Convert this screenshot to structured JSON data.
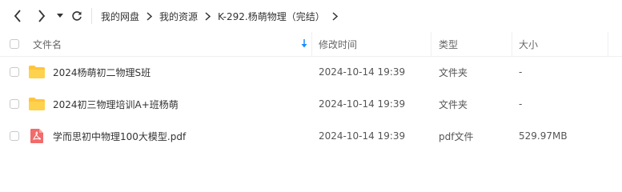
{
  "toolbar": {
    "icons": [
      "back-icon",
      "forward-icon",
      "history-dropdown-icon",
      "refresh-icon"
    ]
  },
  "breadcrumb": {
    "items": [
      "我的网盘",
      "我的资源",
      "K-292.杨萌物理（完结）"
    ]
  },
  "columns": {
    "name": "文件名",
    "modified": "修改时间",
    "type": "类型",
    "size": "大小"
  },
  "sort": {
    "column": "name",
    "icon": "sort-down-arrow-icon",
    "color": "#1a8cff"
  },
  "files": [
    {
      "name": "2024杨萌初二物理S班",
      "modified": "2024-10-14 19:39",
      "type": "文件夹",
      "size": "-",
      "icon": "folder-icon"
    },
    {
      "name": "2024初三物理培训A+班杨萌",
      "modified": "2024-10-14 19:39",
      "type": "文件夹",
      "size": "-",
      "icon": "folder-icon"
    },
    {
      "name": "学而思初中物理100大模型.pdf",
      "modified": "2024-10-14 19:39",
      "type": "pdf文件",
      "size": "529.97MB",
      "icon": "pdf-icon"
    }
  ],
  "colors": {
    "folder": "#ffc43d",
    "pdf": "#f26b6b",
    "accent": "#1a8cff"
  }
}
